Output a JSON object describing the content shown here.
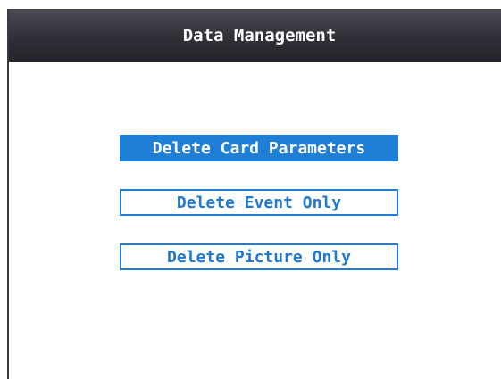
{
  "header": {
    "title": "Data Management"
  },
  "menu": {
    "items": [
      {
        "label": "Delete Card Parameters",
        "selected": true
      },
      {
        "label": "Delete Event Only",
        "selected": false
      },
      {
        "label": "Delete Picture Only",
        "selected": false
      }
    ]
  },
  "colors": {
    "header_bg": "#2e2f36",
    "accent": "#1f7fd6",
    "background": "#ffffff"
  }
}
